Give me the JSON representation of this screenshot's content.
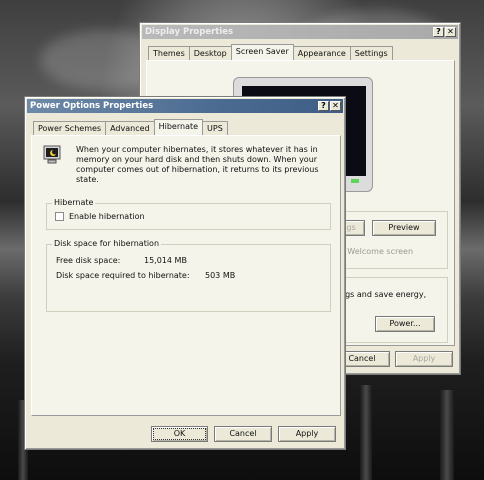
{
  "display_properties": {
    "title": "Display Properties",
    "help_button": "?",
    "close_button": "✕",
    "tabs": [
      "Themes",
      "Desktop",
      "Screen Saver",
      "Appearance",
      "Settings"
    ],
    "selected_tab": "Screen Saver",
    "partial_settings_label": "gs",
    "preview_label": "Preview",
    "welcome_text": "y Welcome screen",
    "power_text": "ngs and save energy,",
    "power_button": "Power...",
    "cancel_button": "Cancel",
    "apply_button": "Apply"
  },
  "power_options": {
    "title": "Power Options Properties",
    "help_button": "?",
    "close_button": "✕",
    "tabs": [
      "Power Schemes",
      "Advanced",
      "Hibernate",
      "UPS"
    ],
    "selected_tab": "Hibernate",
    "description": "When your computer hibernates, it stores whatever it has in\nmemory on your hard disk and then shuts down. When your\ncomputer comes out of hibernation, it returns to its previous state.",
    "hibernate_group": {
      "label": "Hibernate",
      "checkbox_label": "Enable hibernation",
      "checked": false
    },
    "disk_group": {
      "label": "Disk space for hibernation",
      "free_label": "Free disk space:",
      "free_value": "15,014 MB",
      "required_label": "Disk space required to hibernate:",
      "required_value": "503 MB"
    },
    "ok_button": "OK",
    "cancel_button": "Cancel",
    "apply_button": "Apply"
  }
}
